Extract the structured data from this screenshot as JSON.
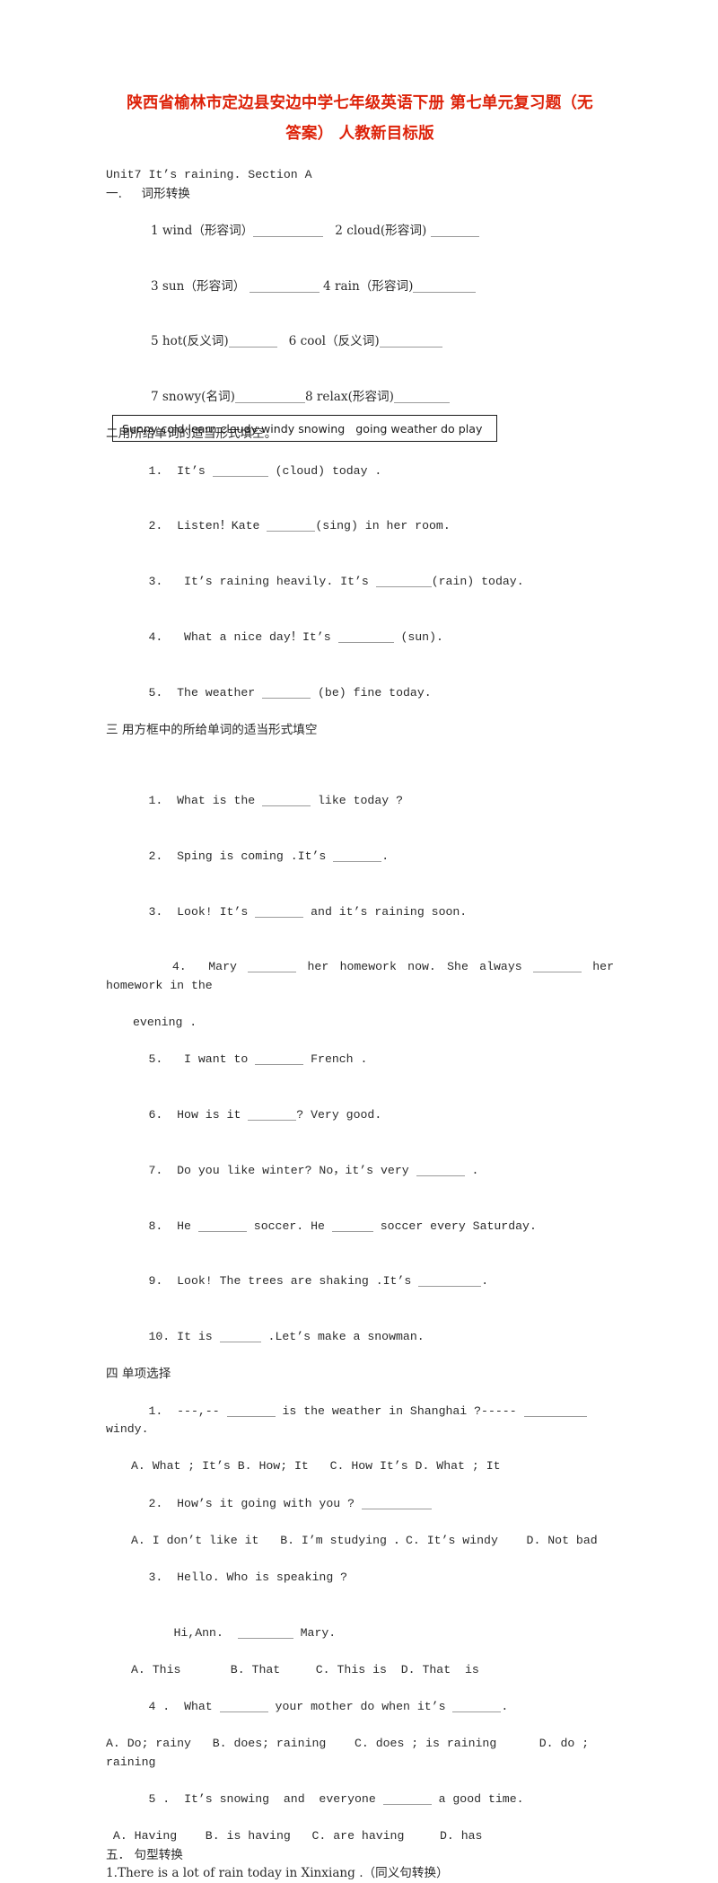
{
  "document": {
    "title_line1": "陕西省榆林市定边县安边中学七年级英语下册 第七单元复习题（无",
    "title_line2": "答案） 人教新目标版",
    "title_color": "#dd2209",
    "unit_heading": "Unit7 It’s raining. Section A"
  },
  "section_one": {
    "heading": "一.     词形转换",
    "items": [
      {
        "left": "1 wind（形容词）",
        "right": "2 cloud(形容词)"
      },
      {
        "left": "3 sun（形容词）",
        "right": "4 rain（形容词)"
      },
      {
        "left": "5 hot(反义词)",
        "right": "6 cool（反义词)"
      },
      {
        "left": "7 snowy(名词)",
        "right": "8 relax(形容词)"
      }
    ]
  },
  "section_two": {
    "heading": "二用所给单词的适当形式填空。",
    "items": [
      {
        "num": "1.",
        "pre": "It’s ",
        "post": " (cloud) today ."
      },
      {
        "num": "2.",
        "pre": "Listen！Kate ",
        "post": "(sing) in her room."
      },
      {
        "num": "3.",
        "pre": " It’s raining heavily. It’s ",
        "post": "(rain) today."
      },
      {
        "num": "4.",
        "pre": " What a nice day！It’s ",
        "post": " (sun)."
      },
      {
        "num": "5.",
        "pre": "The weather ",
        "post": " (be) fine today."
      }
    ]
  },
  "section_three": {
    "heading": "三 用方框中的所给单词的适当形式填空",
    "word_bank": "Sunny cold learn cloudy windy snowing   going weather do play",
    "items": [
      {
        "num": "1.",
        "pre": "What is the ",
        "post": " like today ?"
      },
      {
        "num": "2.",
        "pre": "Sping is coming .It’s ",
        "post": "."
      },
      {
        "num": "3.",
        "pre": "Look! It’s ",
        "post": " and it’s raining soon."
      },
      {
        "num": "4.",
        "pre": "Mary ",
        "mid": " her homework now. She always ",
        "post": " her homework in the"
      },
      {
        "num": "",
        "cont": "evening ."
      },
      {
        "num": "5.",
        "pre": " I want to ",
        "post": " French ."
      },
      {
        "num": "6.",
        "pre": "How is it ",
        "post": "? Very good."
      },
      {
        "num": "7.",
        "pre": "Do you like winter? No，it’s very ",
        "post": " ."
      },
      {
        "num": "8.",
        "pre": "He ",
        "mid": " soccer. He ",
        "post": " soccer every Saturday."
      },
      {
        "num": "9.",
        "pre": "Look! The trees are shaking .It’s ",
        "post": "."
      },
      {
        "num": "10.",
        "pre": "It is ",
        "post": " .Let’s make a snowman."
      }
    ]
  },
  "section_four": {
    "heading": "四 单项选择",
    "questions": [
      {
        "num": "1.",
        "stem_pre": "---,-- ",
        "stem_mid": " is the weather in Shanghai ?----- ",
        "stem_post": " windy.",
        "options": "A. What ; It’s B. How; It   C. How It’s D. What ; It"
      },
      {
        "num": "2.",
        "stem_pre": "How’s it going with you ? ",
        "stem_post": "",
        "options": "A. I don’t like it   B. I’m studying ．C. It’s windy    D. Not bad"
      },
      {
        "num": "3.",
        "stem_pre": "Hello. Who is speaking ?",
        "stem_line2_pre": "Hi,Ann. ",
        "stem_line2_post": " Mary.",
        "options": "A. This       B. That     C. This is  D. That  is"
      },
      {
        "num": "4 .",
        "stem_pre": " What ",
        "stem_mid": " your mother do when it’s ",
        "stem_post": ".",
        "options": "A. Do; rainy   B. does; raining    C. does ; is raining      D. do ; raining"
      },
      {
        "num": "5 .",
        "stem_pre": " It’s snowing  and  everyone ",
        "stem_post": " a good time.",
        "options": " A. Having    B. is having   C. are having     D. has"
      }
    ]
  },
  "section_five": {
    "heading": "五． 句型转换",
    "items": [
      {
        "text": "1.There is a lot of rain today in Xinxiang .（同义句转换）"
      }
    ]
  }
}
